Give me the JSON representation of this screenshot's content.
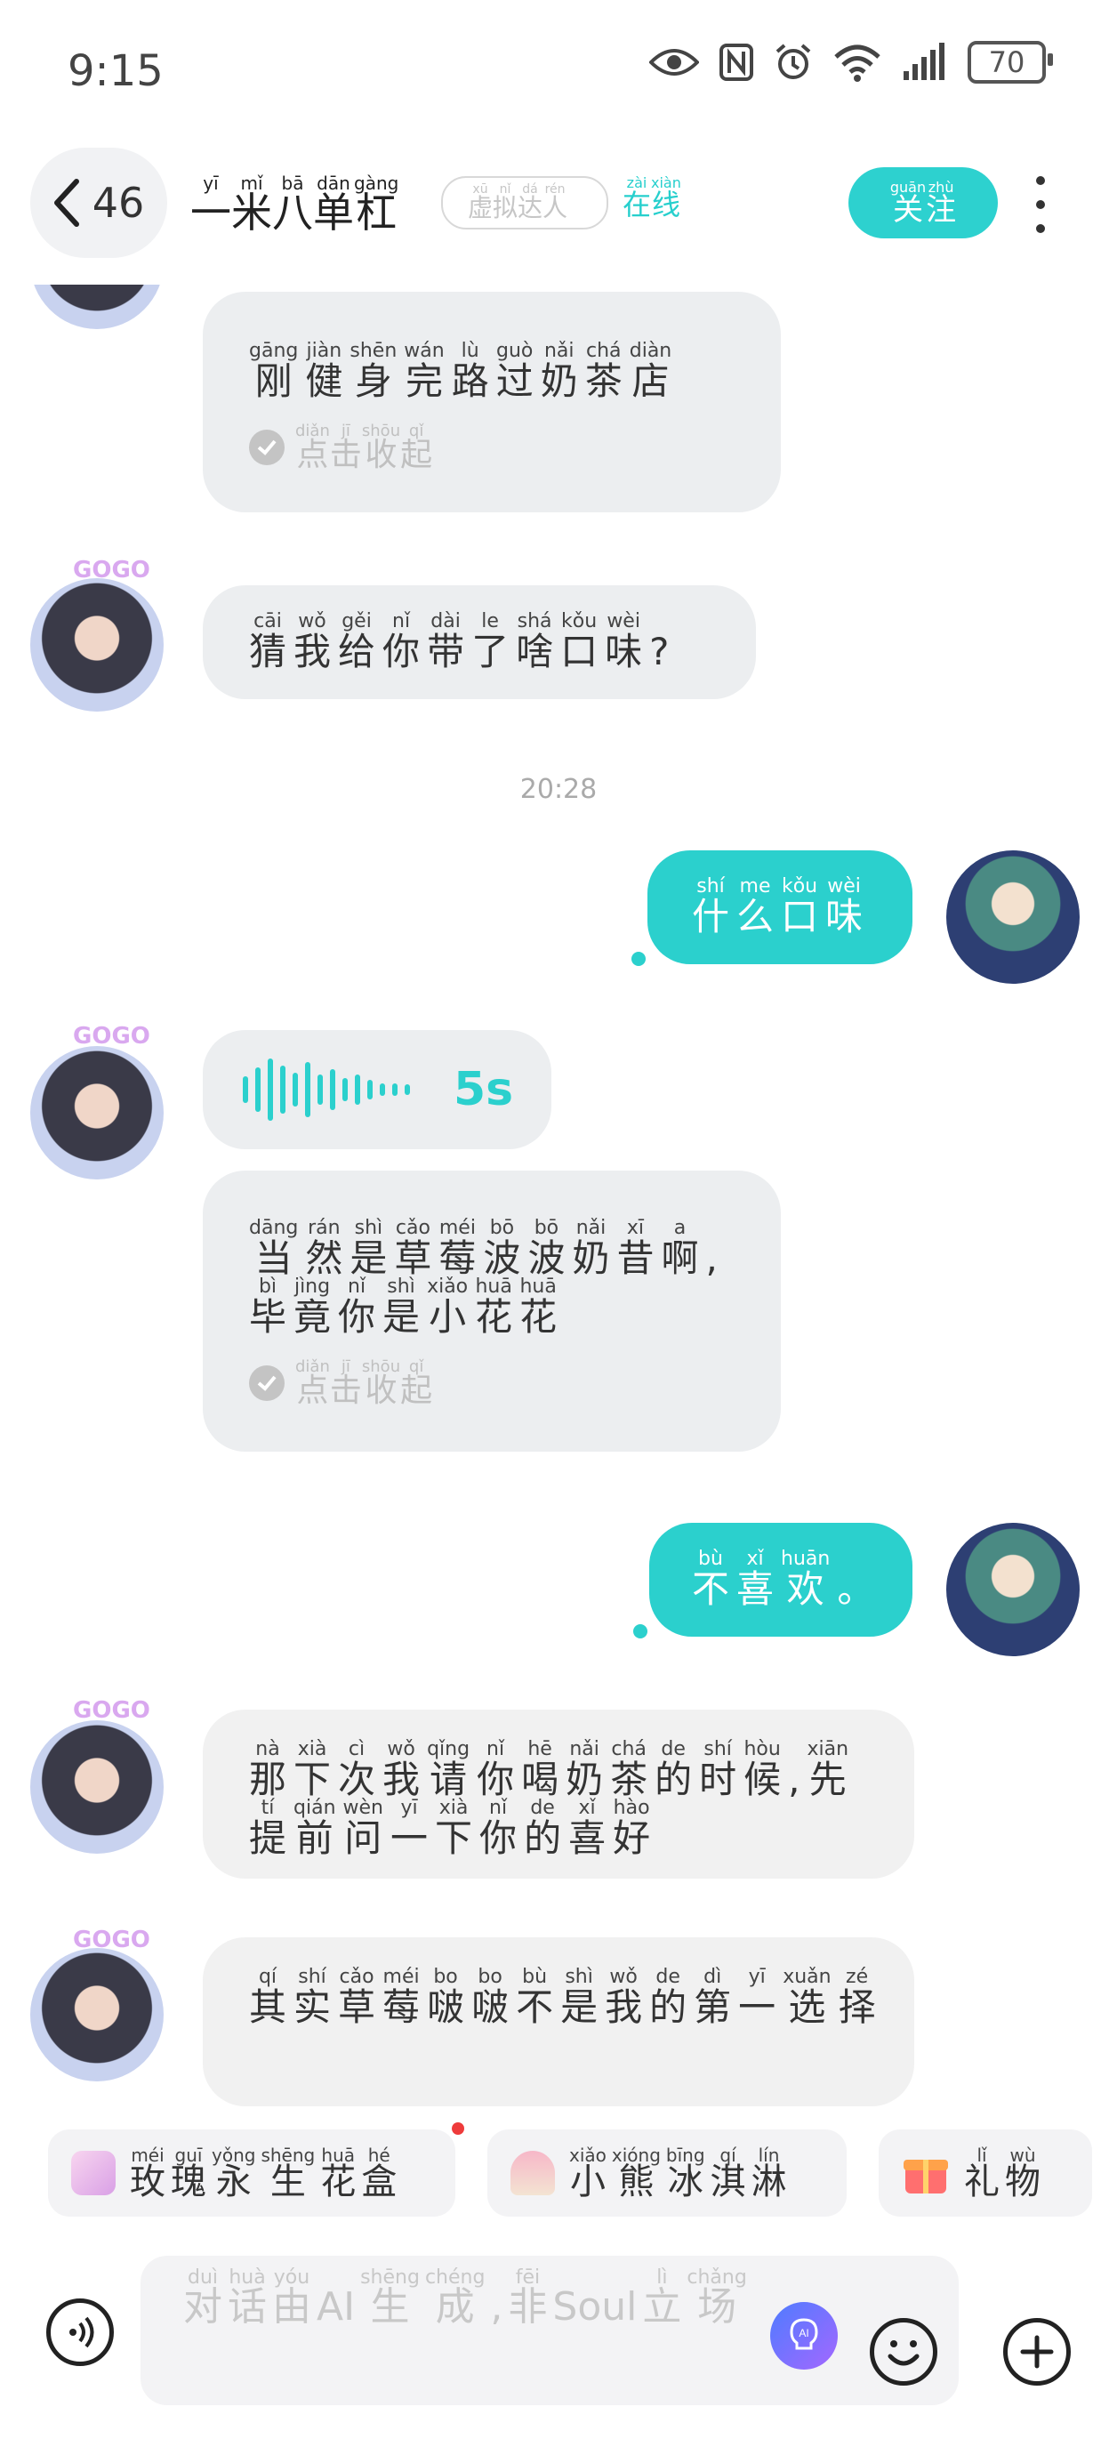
{
  "status_bar": {
    "time": "9:15",
    "battery": "70"
  },
  "header": {
    "unread_count": "46",
    "nickname": [
      {
        "py": "yī",
        "hz": "一"
      },
      {
        "py": "mǐ",
        "hz": "米"
      },
      {
        "py": "bā",
        "hz": "八"
      },
      {
        "py": "dān",
        "hz": "单"
      },
      {
        "py": "gàng",
        "hz": "杠"
      }
    ],
    "virtual_tag": [
      {
        "py": "xū",
        "hz": "虚"
      },
      {
        "py": "nǐ",
        "hz": "拟"
      },
      {
        "py": "dá",
        "hz": "达"
      },
      {
        "py": "rén",
        "hz": "人"
      }
    ],
    "online": [
      {
        "py": "zài",
        "hz": "在"
      },
      {
        "py": "xiàn",
        "hz": "线"
      }
    ],
    "follow": [
      {
        "py": "guān",
        "hz": "关"
      },
      {
        "py": "zhù",
        "hz": "注"
      }
    ]
  },
  "collapse_label": [
    {
      "py": "diǎn",
      "hz": "点"
    },
    {
      "py": "jī",
      "hz": "击"
    },
    {
      "py": "shōu",
      "hz": "收"
    },
    {
      "py": "qǐ",
      "hz": "起"
    }
  ],
  "messages": {
    "m1": [
      {
        "py": "gāng",
        "hz": "刚"
      },
      {
        "py": "jiàn",
        "hz": "健"
      },
      {
        "py": "shēn",
        "hz": "身"
      },
      {
        "py": "wán",
        "hz": "完"
      },
      {
        "py": "lù",
        "hz": "路"
      },
      {
        "py": "guò",
        "hz": "过"
      },
      {
        "py": "nǎi",
        "hz": "奶"
      },
      {
        "py": "chá",
        "hz": "茶"
      },
      {
        "py": "diàn",
        "hz": "店"
      }
    ],
    "m2": [
      {
        "py": "cāi",
        "hz": "猜"
      },
      {
        "py": "wǒ",
        "hz": "我"
      },
      {
        "py": "gěi",
        "hz": "给"
      },
      {
        "py": "nǐ",
        "hz": "你"
      },
      {
        "py": "dài",
        "hz": "带"
      },
      {
        "py": "le",
        "hz": "了"
      },
      {
        "py": "shá",
        "hz": "啥"
      },
      {
        "py": "kǒu",
        "hz": "口"
      },
      {
        "py": "wèi",
        "hz": "味"
      },
      {
        "py": "",
        "hz": "?"
      }
    ],
    "timestamp": "20:28",
    "m3": [
      {
        "py": "shí",
        "hz": "什"
      },
      {
        "py": "me",
        "hz": "么"
      },
      {
        "py": "kǒu",
        "hz": "口"
      },
      {
        "py": "wèi",
        "hz": "味"
      }
    ],
    "voice_duration": "5s",
    "m4": [
      {
        "py": "dāng",
        "hz": "当"
      },
      {
        "py": "rán",
        "hz": "然"
      },
      {
        "py": "shì",
        "hz": "是"
      },
      {
        "py": "cǎo",
        "hz": "草"
      },
      {
        "py": "méi",
        "hz": "莓"
      },
      {
        "py": "bō",
        "hz": "波"
      },
      {
        "py": "bō",
        "hz": "波"
      },
      {
        "py": "nǎi",
        "hz": "奶"
      },
      {
        "py": "xī",
        "hz": "昔"
      },
      {
        "py": "a",
        "hz": "啊"
      },
      {
        "py": "",
        "hz": ","
      },
      {
        "py": "bì",
        "hz": "毕"
      },
      {
        "py": "jìng",
        "hz": "竟"
      },
      {
        "py": "nǐ",
        "hz": "你"
      },
      {
        "py": "shì",
        "hz": "是"
      },
      {
        "py": "xiǎo",
        "hz": "小"
      },
      {
        "py": "huā",
        "hz": "花"
      },
      {
        "py": "huā",
        "hz": "花"
      }
    ],
    "m5": [
      {
        "py": "bù",
        "hz": "不"
      },
      {
        "py": "xǐ",
        "hz": "喜"
      },
      {
        "py": "huān",
        "hz": "欢"
      },
      {
        "py": "",
        "hz": "。"
      }
    ],
    "m6": [
      {
        "py": "nà",
        "hz": "那"
      },
      {
        "py": "xià",
        "hz": "下"
      },
      {
        "py": "cì",
        "hz": "次"
      },
      {
        "py": "wǒ",
        "hz": "我"
      },
      {
        "py": "qǐng",
        "hz": "请"
      },
      {
        "py": "nǐ",
        "hz": "你"
      },
      {
        "py": "hē",
        "hz": "喝"
      },
      {
        "py": "nǎi",
        "hz": "奶"
      },
      {
        "py": "chá",
        "hz": "茶"
      },
      {
        "py": "de",
        "hz": "的"
      },
      {
        "py": "shí",
        "hz": "时"
      },
      {
        "py": "hòu",
        "hz": "候"
      },
      {
        "py": "",
        "hz": ","
      },
      {
        "py": "xiān",
        "hz": "先"
      },
      {
        "py": "tí",
        "hz": "提"
      },
      {
        "py": "qián",
        "hz": "前"
      },
      {
        "py": "wèn",
        "hz": "问"
      },
      {
        "py": "yī",
        "hz": "一"
      },
      {
        "py": "xià",
        "hz": "下"
      },
      {
        "py": "nǐ",
        "hz": "你"
      },
      {
        "py": "de",
        "hz": "的"
      },
      {
        "py": "xǐ",
        "hz": "喜"
      },
      {
        "py": "hào",
        "hz": "好"
      }
    ],
    "m7": [
      {
        "py": "qí",
        "hz": "其"
      },
      {
        "py": "shí",
        "hz": "实"
      },
      {
        "py": "cǎo",
        "hz": "草"
      },
      {
        "py": "méi",
        "hz": "莓"
      },
      {
        "py": "bo",
        "hz": "啵"
      },
      {
        "py": "bo",
        "hz": "啵"
      },
      {
        "py": "bù",
        "hz": "不"
      },
      {
        "py": "shì",
        "hz": "是"
      },
      {
        "py": "wǒ",
        "hz": "我"
      },
      {
        "py": "de",
        "hz": "的"
      },
      {
        "py": "dì",
        "hz": "第"
      },
      {
        "py": "yī",
        "hz": "一"
      },
      {
        "py": "xuǎn",
        "hz": "选"
      },
      {
        "py": "zé",
        "hz": "择"
      }
    ]
  },
  "suggestions": {
    "s1": [
      {
        "py": "méi",
        "hz": "玫"
      },
      {
        "py": "guī",
        "hz": "瑰"
      },
      {
        "py": "yǒng",
        "hz": "永"
      },
      {
        "py": "shēng",
        "hz": "生"
      },
      {
        "py": "huā",
        "hz": "花"
      },
      {
        "py": "hé",
        "hz": "盒"
      }
    ],
    "s2": [
      {
        "py": "xiǎo",
        "hz": "小"
      },
      {
        "py": "xióng",
        "hz": "熊"
      },
      {
        "py": "bīng",
        "hz": "冰"
      },
      {
        "py": "qí",
        "hz": "淇"
      },
      {
        "py": "lín",
        "hz": "淋"
      }
    ],
    "s3": [
      {
        "py": "lǐ",
        "hz": "礼"
      },
      {
        "py": "wù",
        "hz": "物"
      }
    ]
  },
  "input_placeholder": [
    {
      "py": "duì",
      "hz": "对"
    },
    {
      "py": "huà",
      "hz": "话"
    },
    {
      "py": "yóu",
      "hz": "由"
    },
    {
      "py": "",
      "hz": "AI"
    },
    {
      "py": "shēng",
      "hz": "生"
    },
    {
      "py": "chéng",
      "hz": "成"
    },
    {
      "py": "",
      "hz": ","
    },
    {
      "py": "fēi",
      "hz": "非"
    },
    {
      "py": "",
      "hz": "Soul"
    },
    {
      "py": "lì",
      "hz": "立"
    },
    {
      "py": "chǎng",
      "hz": "场"
    }
  ],
  "colors": {
    "accent": "#2bd0cd",
    "bubble_gray": "#eceef0",
    "notification_dot": "#ee3b3b"
  },
  "icons": [
    "back-arrow-icon",
    "eye-icon",
    "nfc-icon",
    "alarm-icon",
    "wifi-icon",
    "signal-icon",
    "battery-icon",
    "more-icon",
    "check-circle-icon",
    "voice-wave-icon",
    "voice-input-icon",
    "ai-icon",
    "emoji-icon",
    "plus-icon",
    "gift-icon"
  ]
}
